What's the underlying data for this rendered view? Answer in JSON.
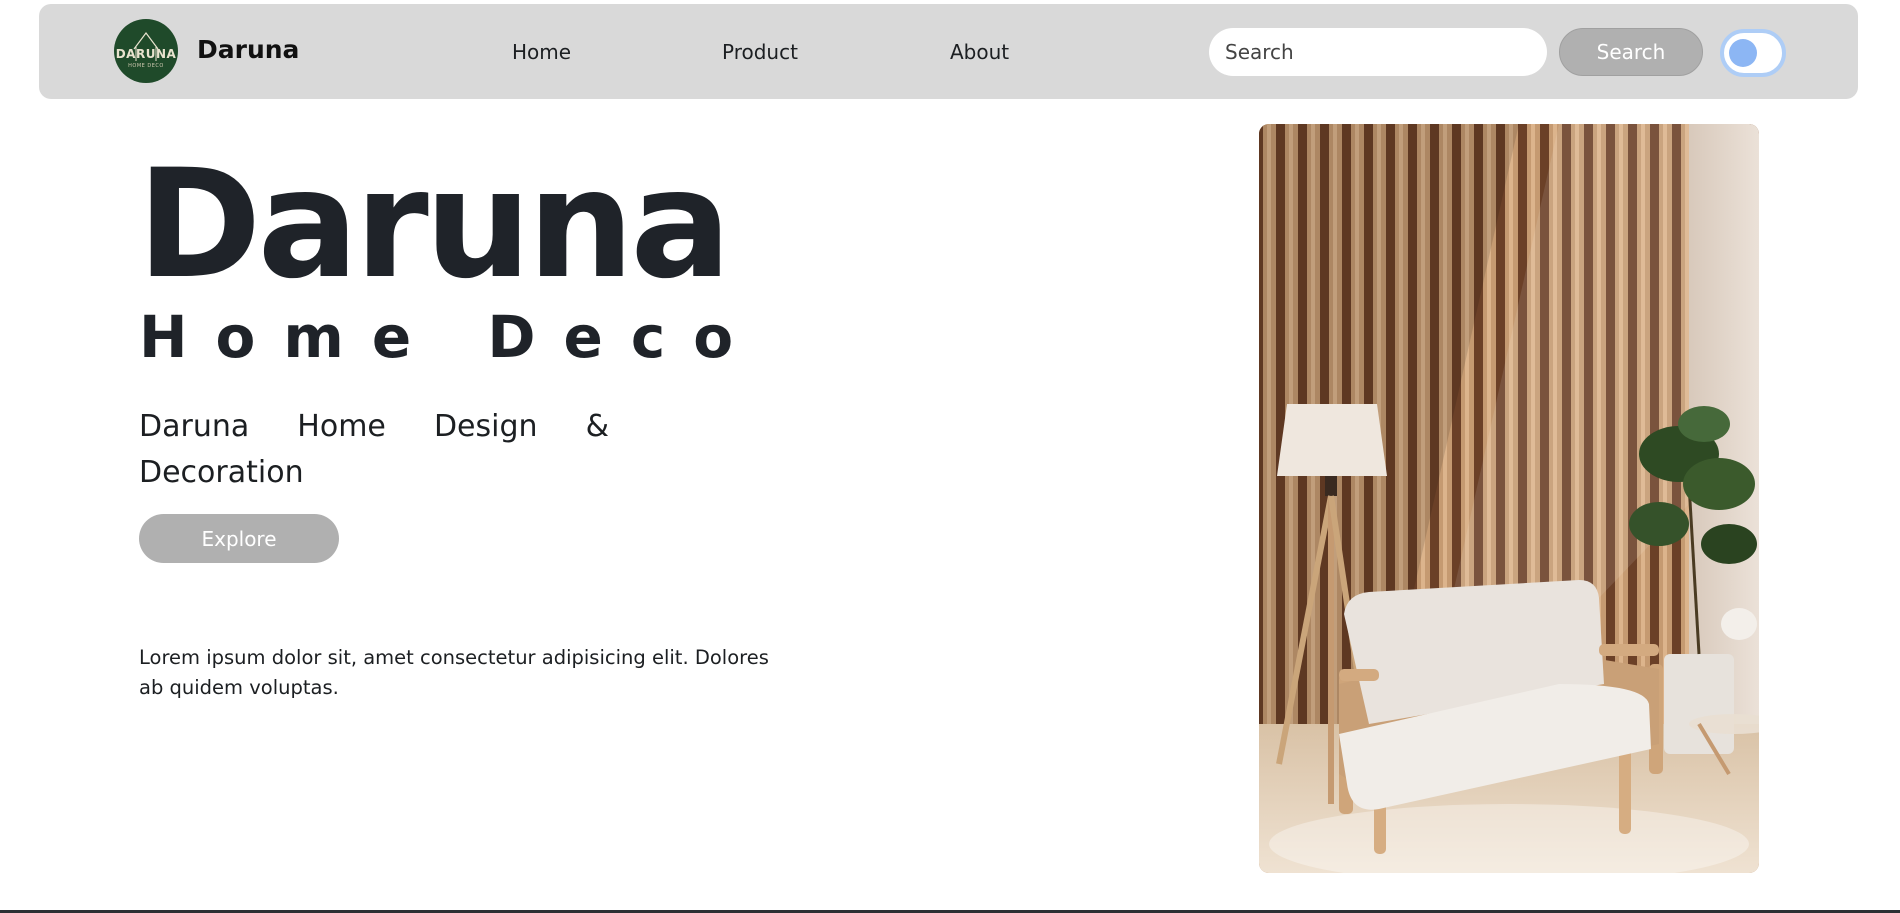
{
  "navbar": {
    "brand": "Daruna",
    "logo_text": "DARUNA",
    "logo_subtext": "HOME DECO",
    "links": [
      {
        "label": "Home"
      },
      {
        "label": "Product"
      },
      {
        "label": "About"
      }
    ],
    "search": {
      "placeholder": "Search",
      "value": "",
      "button_label": "Search"
    },
    "toggle": {
      "state": "off"
    }
  },
  "hero": {
    "title": "Daruna",
    "subtitle": "Home Deco",
    "tagline": "Daruna Home Design & Decoration",
    "explore_label": "Explore",
    "body": "Lorem ipsum dolor sit, amet consectetur adipisicing elit. Dolores ab quidem voluptas."
  },
  "image": {
    "subject": "armchair-with-floor-lamp-and-plant"
  },
  "colors": {
    "navbar_bg": "#d9d9d9",
    "button_gray": "#b0b0b0",
    "logo_green": "#1f4a2a",
    "toggle_blue": "#8cb6f4",
    "text_dark": "#1f2329"
  }
}
